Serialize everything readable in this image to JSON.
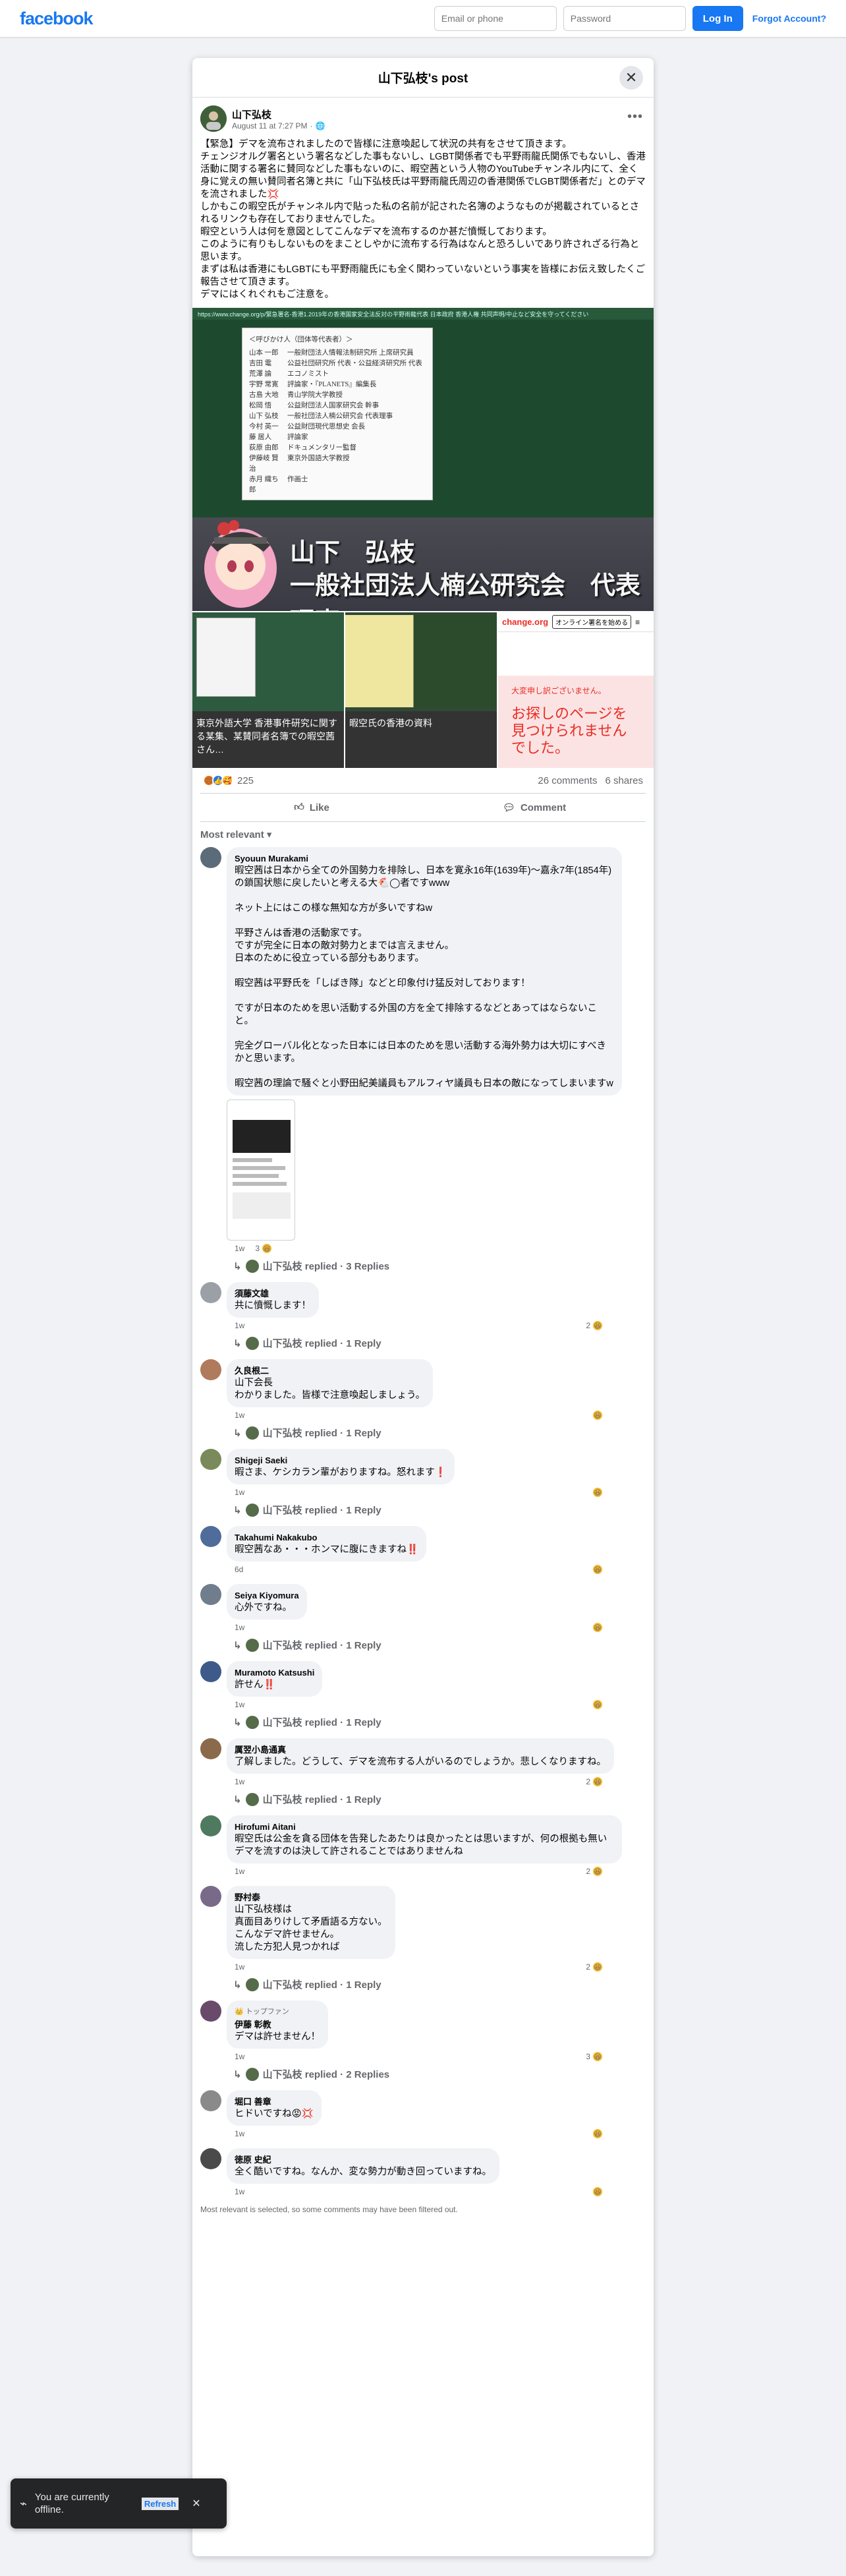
{
  "topbar": {
    "logo": "facebook",
    "email_placeholder": "Email or phone",
    "password_placeholder": "Password",
    "login_label": "Log In",
    "forgot_label": "Forgot Account?"
  },
  "modal": {
    "title": "山下弘枝's post",
    "close": "✕"
  },
  "post": {
    "author": "山下弘枝",
    "date": "August 11 at 7:27 PM",
    "privacy": "🌐",
    "text": "【緊急】デマを流布されましたので皆様に注意喚起して状況の共有をさせて頂きます。\nチェンジオルグ署名という署名などした事もないし、LGBT関係者でも平野雨龍氏関係でもないし、香港活動に関する署名に賛同などした事もないのに、暇空茜という人物のYouTubeチャンネル内にて、全く身に覚えの無い賛同者名簿と共に「山下弘枝氏は平野雨龍氏周辺の香港関係でLGBT関係者だ」とのデマを流されました💢\nしかもこの暇空氏がチャンネル内で貼った私の名前が記された名簿のようなものが掲載されているとされるリンクも存在しておりませんでした。\n暇空という人は何を意図としてこんなデマを流布するのか甚だ憤慨しております。\nこのように有りもしないものをまことしやかに流布する行為はなんと恐ろしいであり許されざる行為と思います。\nまずは私は香港にもLGBTにも平野雨龍氏にも全く関わっていないという事実を皆様にお伝え致したくご報告させて頂きます。\nデマにはくれぐれもご注意を。",
    "image": {
      "urlbar": "https://www.change.org/p/緊急署名-香港1.2019年の香港国家安全法反対の平野雨龍代表 日本政府 香港人権 共同声明/中止など安全を守ってください",
      "paper_header": "＜呼びかけ人（団体等代表者）＞",
      "paper_rows": [
        [
          "山本 一郎",
          "一般財団法人情報法制研究所 上席研究員"
        ],
        [
          "吉田 電",
          "公益社団研究所 代表・公益経済研究所 代表"
        ],
        [
          "荒澤 論",
          "エコノミスト"
        ],
        [
          "宇野 常寛",
          "評論家・『PLANETS』編集長"
        ],
        [
          "古島 大地",
          "青山学院大学教授"
        ],
        [
          "松岡 悟",
          "公益財団法人国家研究会 幹事"
        ],
        [
          "山下 弘枝",
          "一般社団法人楠公研究会 代表理事"
        ],
        [
          "今村 英一",
          "公益財団現代思想史 会長"
        ],
        [
          "藤 居人",
          "評論家"
        ],
        [
          "荻原 由郎",
          "ドキュメンタリー監督"
        ],
        [
          "伊藤岐 賢治",
          "東京外国語大学教授"
        ],
        [
          "赤月 織ち郎",
          "作画士"
        ]
      ],
      "big_name": "山下　弘枝",
      "big_title": "一般社団法人楠公研究会　代表理事",
      "thumb1_caption": "東京外語大学 香港事件研究に関する某集、某賛同者名簿での暇空茜さん…",
      "thumb2_caption": "暇空氏の香港の資料",
      "thumb3_brand": "change.org",
      "thumb3_pill": "オンライン署名を始める",
      "thumb3_sorry": "大変申し訳ございません。",
      "thumb3_notfound": "お探しのページを見つけられませんでした。"
    },
    "reactions_count": "225",
    "comments_count": "26 comments",
    "shares_count": "6 shares",
    "like_label": "Like",
    "comment_label": "Comment",
    "sort_label": "Most relevant ▾"
  },
  "comments": [
    {
      "name": "Syouun Murakami",
      "text": "暇空茜は日本から全ての外国勢力を排除し、日本を寛永16年(1639年)〜嘉永7年(1854年)の鎖国状態に戻したいと考える大🐔◯者ですwww\n\nネット上にはこの様な無知な方が多いですねw\n\n平野さんは香港の活動家です。\nですが完全に日本の敵対勢力とまでは言えません。\n日本のために役立っている部分もあります。\n\n暇空茜は平野氏を「しばき隊」などと印象付け猛反対しております！\n\nですが日本のためを思い活動する外国の方を全て排除するなどとあってはならないこと。\n\n完全グローバル化となった日本には日本のためを思い活動する海外勢力は大切にすべきかと思います。\n\n暇空茜の理論で騒ぐと小野田紀美議員もアルフィヤ議員も日本の敵になってしまいますw",
      "time": "1w",
      "react": "3",
      "replies": "山下弘枝 replied · 3 Replies"
    },
    {
      "name": "須藤文雄",
      "text": "共に憤慨します！",
      "time": "1w",
      "react": "2",
      "replies": "山下弘枝 replied · 1 Reply"
    },
    {
      "name": "久良根二",
      "text": "山下会長\nわかりました。皆様で注意喚起しましょう。",
      "time": "1w",
      "react": "",
      "replies": "山下弘枝 replied · 1 Reply"
    },
    {
      "name": "Shigeji Saeki",
      "text": "暇さま、ケシカラン輩がおりますね。怒れます❗",
      "time": "1w",
      "react": "",
      "replies": "山下弘枝 replied · 1 Reply"
    },
    {
      "name": "Takahumi Nakakubo",
      "text": "暇空茜なあ・・・ホンマに腹にきますね‼️",
      "time": "6d",
      "react": "",
      "replies": ""
    },
    {
      "name": "Seiya Kiyomura",
      "text": "心外ですね。",
      "time": "1w",
      "react": "",
      "replies": "山下弘枝 replied · 1 Reply"
    },
    {
      "name": "Muramoto Katsushi",
      "text": "許せん‼️",
      "time": "1w",
      "react": "",
      "replies": "山下弘枝 replied · 1 Reply"
    },
    {
      "name": "厲翌小島通真",
      "text": "了解しました。どうして、デマを流布する人がいるのでしょうか。悲しくなりますね。",
      "time": "1w",
      "react": "2",
      "replies": "山下弘枝 replied · 1 Reply"
    },
    {
      "name": "Hirofumi Aitani",
      "text": "暇空氏は公金を貪る団体を告発したあたりは良かったとは思いますが、何の根拠も無いデマを流すのは決して許されることではありませんね",
      "time": "1w",
      "react": "2",
      "replies": ""
    },
    {
      "name": "野村泰",
      "text": "山下弘枝様は\n真面目ありけして矛盾語る方ない。\nこんなデマ許せません。\n流した方犯人見つかれば",
      "time": "1w",
      "react": "2",
      "replies": "山下弘枝 replied · 1 Reply"
    },
    {
      "name": "伊藤 彰教",
      "badge": "👑 トップファン",
      "text": "デマは許せません！",
      "time": "1w",
      "react": "3",
      "replies": "山下弘枝 replied · 2 Replies"
    },
    {
      "name": "堀口 善章",
      "text": "ヒドいですね😡💢",
      "time": "1w",
      "react": "",
      "replies": ""
    },
    {
      "name": "徳原 史紀",
      "text": "全く酷いですね。なんか、変な勢力が動き回っていますね。",
      "time": "1w",
      "react": "",
      "replies": ""
    }
  ],
  "footnote": "Most relevant is selected, so some comments may have been filtered out.",
  "toast": {
    "message": "You are currently offline.",
    "reload": "Refresh",
    "close": "✕"
  }
}
